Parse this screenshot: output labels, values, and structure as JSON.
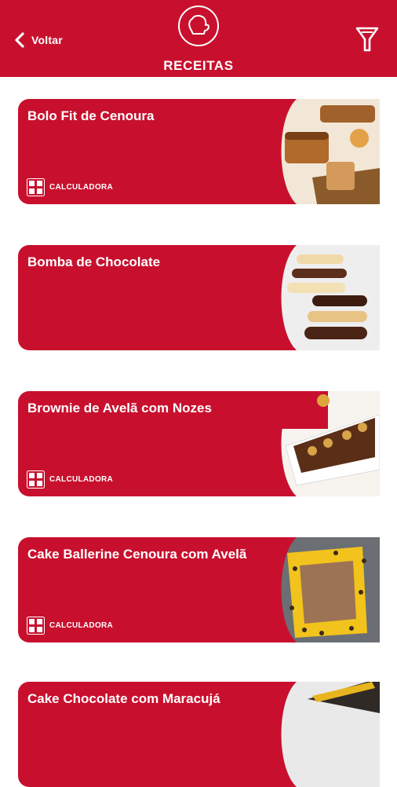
{
  "header": {
    "back_label": "Voltar",
    "title": "RECEITAS",
    "logo_icon": "oven-mitt-icon",
    "filter_icon": "filter-funnel-icon",
    "background_color": "#c8102e"
  },
  "recipes": [
    {
      "title": "Bolo Fit de Cenoura",
      "calculator_label": "CALCULADORA",
      "image": "carrot-cake-loaf-photo"
    },
    {
      "title": "Bomba de Chocolate",
      "image": "chocolate-eclairs-photo"
    },
    {
      "title": "Brownie de Avelã com Nozes",
      "calculator_label": "CALCULADORA",
      "image": "hazelnut-brownie-photo"
    },
    {
      "title": "Cake Ballerine Cenoura com Avelã",
      "calculator_label": "CALCULADORA",
      "image": "carrot-hazelnut-cake-photo"
    },
    {
      "title": "Cake Chocolate com Maracujá",
      "image": "chocolate-passionfruit-cake-photo"
    }
  ],
  "colors": {
    "card": "#c8102e",
    "text": "#ffffff"
  }
}
